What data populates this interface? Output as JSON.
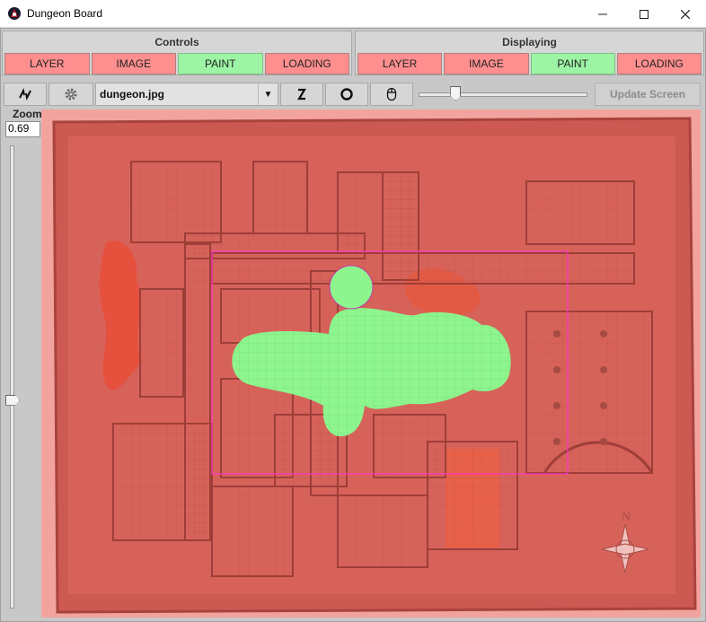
{
  "window": {
    "title": "Dungeon Board"
  },
  "controls": {
    "title": "Controls",
    "tabs": [
      {
        "label": "LAYER",
        "state": "red"
      },
      {
        "label": "IMAGE",
        "state": "red"
      },
      {
        "label": "PAINT",
        "state": "green"
      },
      {
        "label": "LOADING",
        "state": "red"
      }
    ]
  },
  "displaying": {
    "title": "Displaying",
    "tabs": [
      {
        "label": "LAYER",
        "state": "red"
      },
      {
        "label": "IMAGE",
        "state": "red"
      },
      {
        "label": "PAINT",
        "state": "green"
      },
      {
        "label": "LOADING",
        "state": "red"
      }
    ]
  },
  "toolbar": {
    "image_select": "dungeon.jpg",
    "update_button": "Update Screen",
    "brush_slider_value": 0.2
  },
  "zoom": {
    "label": "Zoom",
    "value": "0.69",
    "slider_value": 0.45
  },
  "map": {
    "compass_letter": "N",
    "colors": {
      "fog": "#e86a62",
      "revealed": "#8ef58e",
      "selection": "#ff33cc"
    }
  }
}
